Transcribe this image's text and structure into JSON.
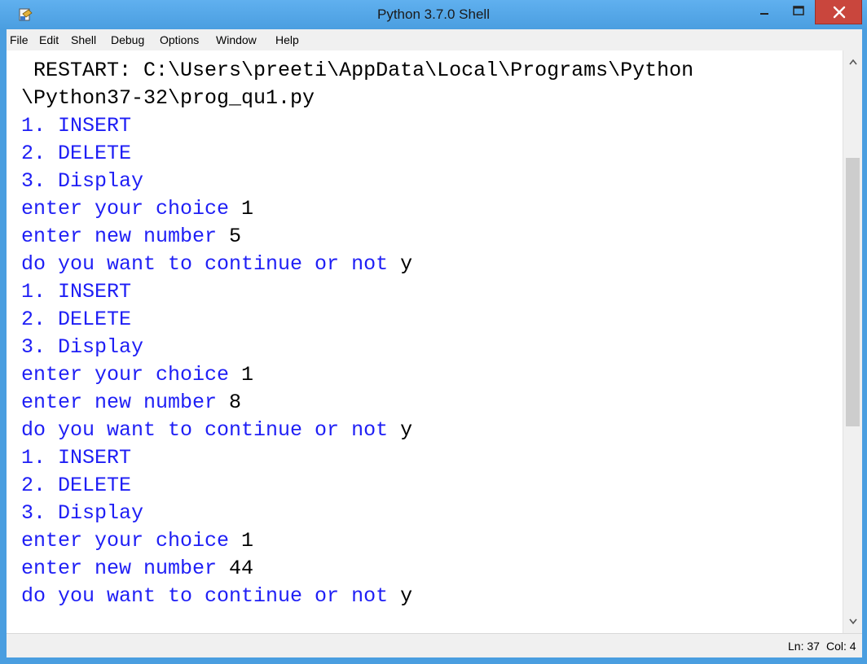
{
  "window": {
    "title": "Python 3.7.0 Shell"
  },
  "menu": [
    "File",
    "Edit",
    "Shell",
    "Debug",
    "Options",
    "Window",
    "Help"
  ],
  "lines": [
    {
      "parts": [
        {
          "text": " RESTART: C:\\Users\\preeti\\AppData\\Local\\Programs\\Python",
          "kind": "restart"
        }
      ]
    },
    {
      "parts": [
        {
          "text": "\\Python37-32\\prog_qu1.py",
          "kind": "restart"
        }
      ]
    },
    {
      "parts": [
        {
          "text": "1. INSERT",
          "kind": "out"
        }
      ]
    },
    {
      "parts": [
        {
          "text": "2. DELETE",
          "kind": "out"
        }
      ]
    },
    {
      "parts": [
        {
          "text": "3. Display",
          "kind": "out"
        }
      ]
    },
    {
      "parts": [
        {
          "text": "enter your choice ",
          "kind": "out"
        },
        {
          "text": "1",
          "kind": "inp"
        }
      ]
    },
    {
      "parts": [
        {
          "text": "enter new number ",
          "kind": "out"
        },
        {
          "text": "5",
          "kind": "inp"
        }
      ]
    },
    {
      "parts": [
        {
          "text": "do you want to continue or not ",
          "kind": "out"
        },
        {
          "text": "y",
          "kind": "inp"
        }
      ]
    },
    {
      "parts": [
        {
          "text": "1. INSERT",
          "kind": "out"
        }
      ]
    },
    {
      "parts": [
        {
          "text": "2. DELETE",
          "kind": "out"
        }
      ]
    },
    {
      "parts": [
        {
          "text": "3. Display",
          "kind": "out"
        }
      ]
    },
    {
      "parts": [
        {
          "text": "enter your choice ",
          "kind": "out"
        },
        {
          "text": "1",
          "kind": "inp"
        }
      ]
    },
    {
      "parts": [
        {
          "text": "enter new number ",
          "kind": "out"
        },
        {
          "text": "8",
          "kind": "inp"
        }
      ]
    },
    {
      "parts": [
        {
          "text": "do you want to continue or not ",
          "kind": "out"
        },
        {
          "text": "y",
          "kind": "inp"
        }
      ]
    },
    {
      "parts": [
        {
          "text": "1. INSERT",
          "kind": "out"
        }
      ]
    },
    {
      "parts": [
        {
          "text": "2. DELETE",
          "kind": "out"
        }
      ]
    },
    {
      "parts": [
        {
          "text": "3. Display",
          "kind": "out"
        }
      ]
    },
    {
      "parts": [
        {
          "text": "enter your choice ",
          "kind": "out"
        },
        {
          "text": "1",
          "kind": "inp"
        }
      ]
    },
    {
      "parts": [
        {
          "text": "enter new number ",
          "kind": "out"
        },
        {
          "text": "44",
          "kind": "inp"
        }
      ]
    },
    {
      "parts": [
        {
          "text": "do you want to continue or not ",
          "kind": "out"
        },
        {
          "text": "y",
          "kind": "inp"
        }
      ]
    }
  ],
  "status": {
    "line": "Ln: 37",
    "col": "Col: 4"
  },
  "colors": {
    "output": "#1e1ef5",
    "input": "#000000",
    "titlebar": "#4a9ee0",
    "close": "#c9463d"
  },
  "icons": {
    "app": "python-idle-icon",
    "minimize": "minimize-icon",
    "maximize": "maximize-icon",
    "close": "close-icon"
  }
}
